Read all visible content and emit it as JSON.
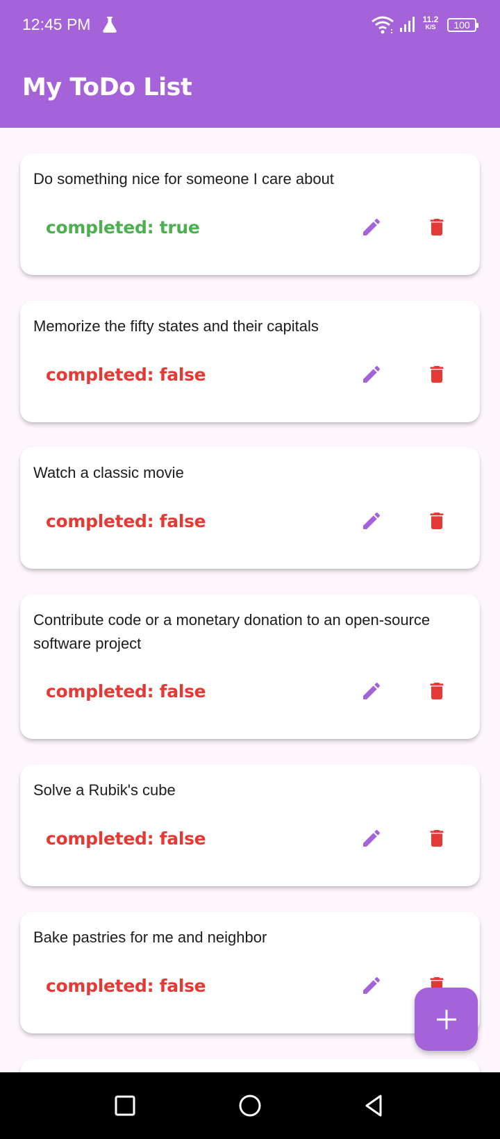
{
  "status_bar": {
    "time": "12:45 PM",
    "net_speed_value": "11.2",
    "net_speed_unit": "K/S",
    "battery": "100",
    "icons": [
      "flask-icon",
      "wifi-icon",
      "signal-icon",
      "battery-icon"
    ]
  },
  "app_bar": {
    "title": "My ToDo List",
    "background_color": "#a463d9"
  },
  "todos": [
    {
      "title": "Do something nice for someone I care about",
      "status": "completed: true"
    },
    {
      "title": "Memorize the fifty states and their capitals",
      "status": "completed: false"
    },
    {
      "title": "Watch a classic movie",
      "status": "completed: false"
    },
    {
      "title": "Contribute code or a monetary donation to an open-source software project",
      "status": "completed: false"
    },
    {
      "title": "Solve a Rubik's cube",
      "status": "completed: false"
    },
    {
      "title": "Bake pastries for me and neighbor",
      "status": "completed: false"
    }
  ],
  "icons": {
    "edit": "edit-pencil-icon",
    "delete": "delete-trash-icon",
    "add": "plus-icon"
  },
  "colors": {
    "completed_true": "#4caf50",
    "completed_false": "#e53935",
    "edit_icon": "#a463d9",
    "delete_icon": "#e53935",
    "fab": "#a463d9"
  },
  "nav_bar": {
    "buttons": [
      "recent-apps-icon",
      "home-icon",
      "back-icon"
    ]
  }
}
